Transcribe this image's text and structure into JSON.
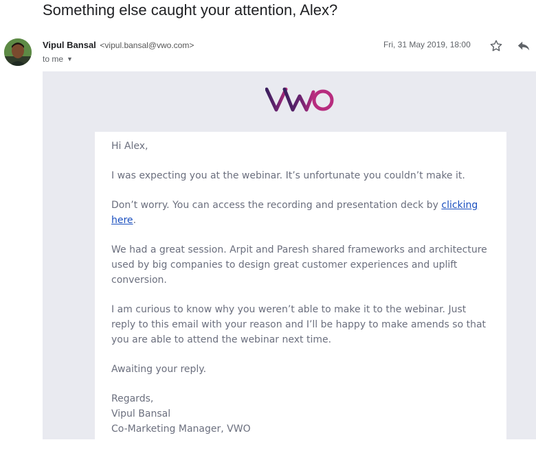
{
  "email": {
    "subject": "Something else caught your attention, Alex?",
    "sender_name": "Vipul Bansal",
    "sender_email": "<vipul.bansal@vwo.com>",
    "recipient": "to me",
    "date": "Fri, 31 May 2019, 18:00"
  },
  "icons": {
    "avatar": "profile-photo",
    "caret": "caret-down-icon",
    "star": "star-icon",
    "reply": "reply-icon"
  },
  "brand": {
    "logo_text": "VWO",
    "logo_color_left": "#3b1f5e",
    "logo_color_right": "#b72c7e"
  },
  "message": {
    "greeting": "Hi Alex,",
    "p1": "I was expecting you at the webinar. It’s unfortunate you couldn’t make it.",
    "p2_before": "Don’t worry. You can access the recording and presentation deck by ",
    "p2_link": "clicking here",
    "p2_after": ".",
    "p3": "We had a great session. Arpit and Paresh shared frameworks and architecture used by big companies to design great customer experiences and uplift conversion.",
    "p4": "I am curious to know why you weren’t able to make it to the webinar. Just reply to this email with your reason and I’ll be happy to make amends so that you are able to attend the webinar next time.",
    "p5": "Awaiting your reply.",
    "closing": "Regards,",
    "signature_name": "Vipul Bansal",
    "signature_title": "Co-Marketing Manager, VWO"
  },
  "colors": {
    "email_background": "#e9eaf0",
    "body_text": "#6b6f7e",
    "link": "#1a4fbf"
  }
}
